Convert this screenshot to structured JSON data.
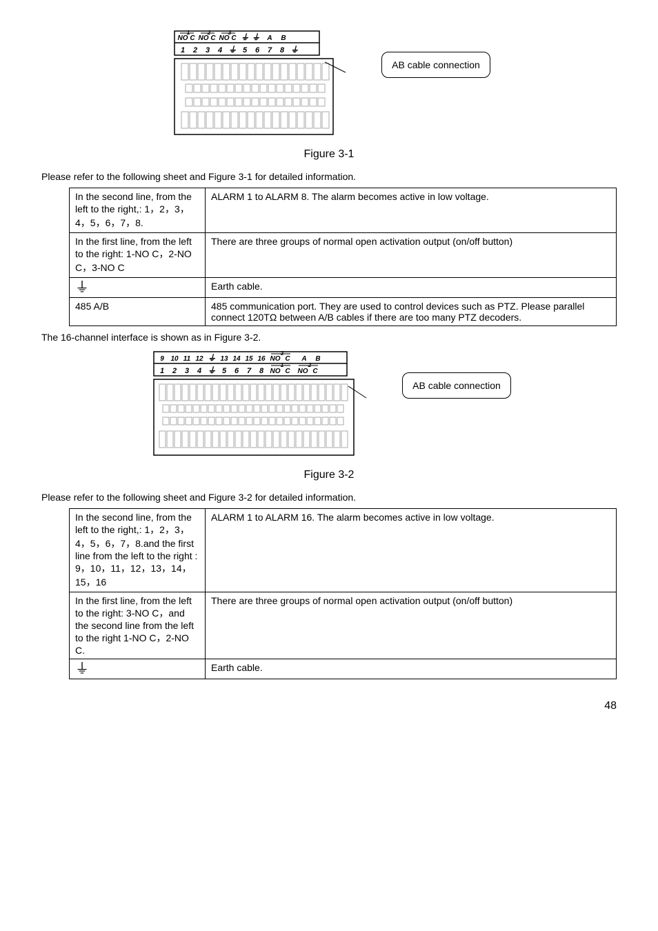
{
  "figure1": {
    "caption": "Figure 3-1",
    "top_labels": [
      "NO",
      "C",
      "NO",
      "C",
      "NO",
      "C",
      "⏚",
      "⏚",
      "A",
      "B"
    ],
    "top_nums": [
      "1",
      "2",
      "3"
    ],
    "bottom_labels": [
      "1",
      "2",
      "3",
      "4",
      "⏚",
      "5",
      "6",
      "7",
      "8",
      "⏚"
    ],
    "callout": "AB cable connection"
  },
  "intro1": "Please refer to the following sheet and Figure 3-1 for detailed information.",
  "table1": {
    "rows": [
      {
        "left": "In the second  line, from the left to the right,: 1，2，3，4，5，6，7，8.",
        "right": "ALARM 1 to ALARM 8. The alarm becomes active in low voltage."
      },
      {
        "left": "In the first  line, from the left to the right: 1-NO C，2-NO C，3-NO C",
        "right": "There are three groups of normal open activation output (on/off button)"
      },
      {
        "left": "⏚",
        "right": "Earth cable."
      },
      {
        "left": "485 A/B",
        "right": "485 communication port. They are used to control devices such as PTZ. Please parallel connect 120TΩ between A/B cables if there are too many PTZ decoders."
      }
    ]
  },
  "mid_text": "The 16-channel interface is shown as in Figure 3-2.",
  "figure2": {
    "caption": "Figure 3-2",
    "top_labels": [
      "9",
      "10",
      "11",
      "12",
      "⏚",
      "13",
      "14",
      "15",
      "16",
      "NO",
      "C",
      "A",
      "B"
    ],
    "top_num": "3",
    "bottom_labels": [
      "1",
      "2",
      "3",
      "4",
      "⏚",
      "5",
      "6",
      "7",
      "8",
      "NO",
      "C",
      "NO",
      "C"
    ],
    "bottom_nums": [
      "1",
      "2"
    ],
    "callout": "AB cable connection"
  },
  "intro2": "Please refer to the following sheet and Figure 3-2 for detailed information.",
  "table2": {
    "rows": [
      {
        "left": "In the second  line, from the left to the right,: 1，2，3，4，5，6，7，8.and the first line from the left to the right : 9，10，11，12，13，14，15，16",
        "right": "ALARM 1 to ALARM 16. The alarm becomes active in low voltage."
      },
      {
        "left": "In the first  line, from the left to the right: 3-NO C，and the second line from the left to the right  1-NO C，2-NO C.",
        "right": "There are three groups of normal open activation output (on/off button)"
      },
      {
        "left": "⏚",
        "right": "Earth cable."
      }
    ]
  },
  "page_number": "48"
}
